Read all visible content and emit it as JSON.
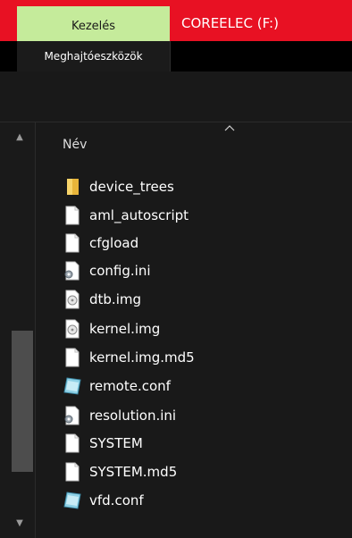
{
  "ribbon": {
    "context_tab": "Kezelés",
    "window_title": "COREELEC (F:)",
    "sub_tab": "Meghajtóeszközök"
  },
  "colors": {
    "title_bar": "#e81123",
    "context_tab": "#c5eb9b",
    "background": "#191919"
  },
  "list": {
    "column_name": "Név",
    "files": [
      {
        "name": "device_trees",
        "icon": "folder-icon"
      },
      {
        "name": "aml_autoscript",
        "icon": "file-icon"
      },
      {
        "name": "cfgload",
        "icon": "file-icon"
      },
      {
        "name": "config.ini",
        "icon": "settings-file-icon"
      },
      {
        "name": "dtb.img",
        "icon": "disc-image-icon"
      },
      {
        "name": "kernel.img",
        "icon": "disc-image-icon"
      },
      {
        "name": "kernel.img.md5",
        "icon": "file-icon"
      },
      {
        "name": "remote.conf",
        "icon": "config-file-icon"
      },
      {
        "name": "resolution.ini",
        "icon": "settings-file-icon"
      },
      {
        "name": "SYSTEM",
        "icon": "file-icon"
      },
      {
        "name": "SYSTEM.md5",
        "icon": "file-icon"
      },
      {
        "name": "vfd.conf",
        "icon": "config-file-icon"
      }
    ]
  }
}
